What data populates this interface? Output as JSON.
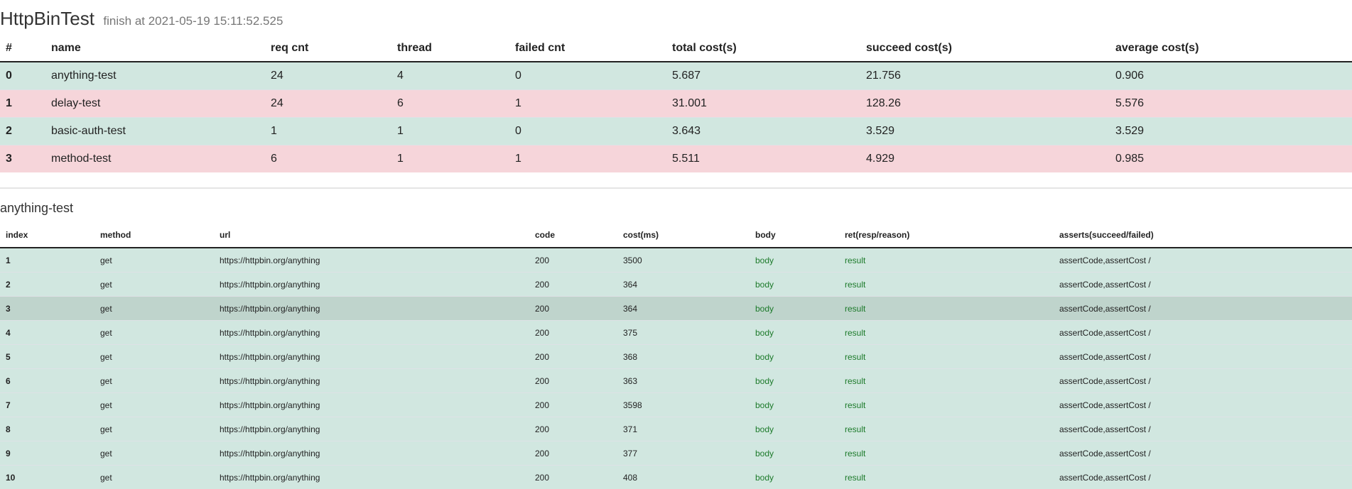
{
  "header": {
    "title": "HttpBinTest",
    "finish_text": "finish at 2021-05-19 15:11:52.525"
  },
  "summary": {
    "columns": [
      "#",
      "name",
      "req cnt",
      "thread",
      "failed cnt",
      "total cost(s)",
      "succeed cost(s)",
      "average cost(s)"
    ],
    "rows": [
      {
        "index": "0",
        "name": "anything-test",
        "req_cnt": "24",
        "thread": "4",
        "failed_cnt": "0",
        "total_cost": "5.687",
        "succeed_cost": "21.756",
        "average_cost": "0.906",
        "status": "success"
      },
      {
        "index": "1",
        "name": "delay-test",
        "req_cnt": "24",
        "thread": "6",
        "failed_cnt": "1",
        "total_cost": "31.001",
        "succeed_cost": "128.26",
        "average_cost": "5.576",
        "status": "failed"
      },
      {
        "index": "2",
        "name": "basic-auth-test",
        "req_cnt": "1",
        "thread": "1",
        "failed_cnt": "0",
        "total_cost": "3.643",
        "succeed_cost": "3.529",
        "average_cost": "3.529",
        "status": "success"
      },
      {
        "index": "3",
        "name": "method-test",
        "req_cnt": "6",
        "thread": "1",
        "failed_cnt": "1",
        "total_cost": "5.511",
        "succeed_cost": "4.929",
        "average_cost": "0.985",
        "status": "failed"
      }
    ]
  },
  "detail": {
    "title": "anything-test",
    "columns": [
      "index",
      "method",
      "url",
      "code",
      "cost(ms)",
      "body",
      "ret(resp/reason)",
      "asserts(succeed/failed)"
    ],
    "rows": [
      {
        "index": "1",
        "method": "get",
        "url": "https://httpbin.org/anything",
        "code": "200",
        "cost": "3500",
        "body": "body",
        "ret": "result",
        "asserts": "assertCode,assertCost /"
      },
      {
        "index": "2",
        "method": "get",
        "url": "https://httpbin.org/anything",
        "code": "200",
        "cost": "364",
        "body": "body",
        "ret": "result",
        "asserts": "assertCode,assertCost /"
      },
      {
        "index": "3",
        "method": "get",
        "url": "https://httpbin.org/anything",
        "code": "200",
        "cost": "364",
        "body": "body",
        "ret": "result",
        "asserts": "assertCode,assertCost /"
      },
      {
        "index": "4",
        "method": "get",
        "url": "https://httpbin.org/anything",
        "code": "200",
        "cost": "375",
        "body": "body",
        "ret": "result",
        "asserts": "assertCode,assertCost /"
      },
      {
        "index": "5",
        "method": "get",
        "url": "https://httpbin.org/anything",
        "code": "200",
        "cost": "368",
        "body": "body",
        "ret": "result",
        "asserts": "assertCode,assertCost /"
      },
      {
        "index": "6",
        "method": "get",
        "url": "https://httpbin.org/anything",
        "code": "200",
        "cost": "363",
        "body": "body",
        "ret": "result",
        "asserts": "assertCode,assertCost /"
      },
      {
        "index": "7",
        "method": "get",
        "url": "https://httpbin.org/anything",
        "code": "200",
        "cost": "3598",
        "body": "body",
        "ret": "result",
        "asserts": "assertCode,assertCost /"
      },
      {
        "index": "8",
        "method": "get",
        "url": "https://httpbin.org/anything",
        "code": "200",
        "cost": "371",
        "body": "body",
        "ret": "result",
        "asserts": "assertCode,assertCost /"
      },
      {
        "index": "9",
        "method": "get",
        "url": "https://httpbin.org/anything",
        "code": "200",
        "cost": "377",
        "body": "body",
        "ret": "result",
        "asserts": "assertCode,assertCost /"
      },
      {
        "index": "10",
        "method": "get",
        "url": "https://httpbin.org/anything",
        "code": "200",
        "cost": "408",
        "body": "body",
        "ret": "result",
        "asserts": "assertCode,assertCost /"
      }
    ]
  },
  "colors": {
    "success_row": "#d1e7e0",
    "failed_row": "#f6d5da",
    "hover_row": "#bfd4cc",
    "link": "#1c7a2a"
  }
}
